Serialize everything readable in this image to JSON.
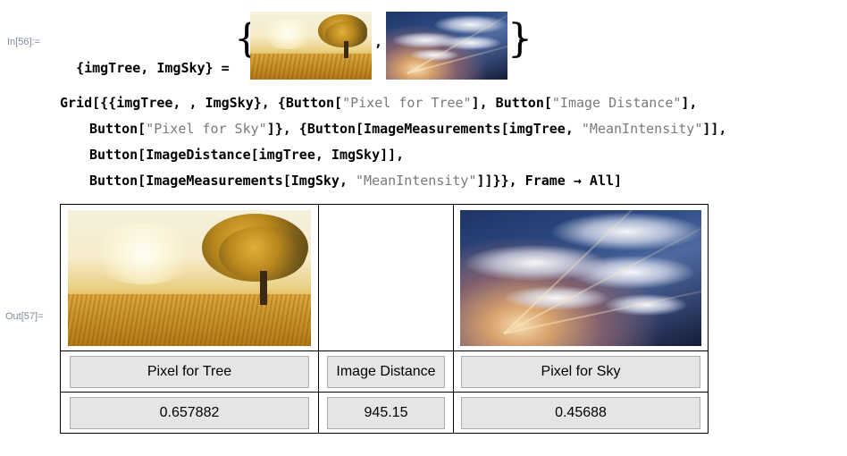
{
  "input_cell": {
    "label_in56": "In[56]:=",
    "line1_prefix": "{imgTree, ImgSky} = ",
    "line1_comma": ",",
    "line1_suffix": "};",
    "left_brace": "{",
    "right_brace": "}"
  },
  "grid_code": {
    "l1_a": "Grid[{{imgTree, , ImgSky}, {Button[",
    "l1_s1": "\"Pixel for Tree\"",
    "l1_b": "], Button[",
    "l1_s2": "\"Image Distance\"",
    "l1_c": "],",
    "l2_a": "Button[",
    "l2_s1": "\"Pixel for Sky\"",
    "l2_b": "]}, {Button[ImageMeasurements[imgTree, ",
    "l2_s2": "\"MeanIntensity\"",
    "l2_c": "]],",
    "l3": "Button[ImageDistance[imgTree, ImgSky]],",
    "l4_a": "Button[ImageMeasurements[ImgSky, ",
    "l4_s1": "\"MeanIntensity\"",
    "l4_b": "]]}}, Frame → All]"
  },
  "output_cell": {
    "label_out57": "Out[57]=",
    "buttons_row1": [
      "Pixel for Tree",
      "Image Distance",
      "Pixel for Sky"
    ],
    "buttons_row2": [
      "0.657882",
      "945.15",
      "0.45688"
    ]
  },
  "colors": {
    "string_literal": "#7a7a7a",
    "button_bg": "#e5e5e5",
    "cell_label": "#7f8a9b"
  }
}
